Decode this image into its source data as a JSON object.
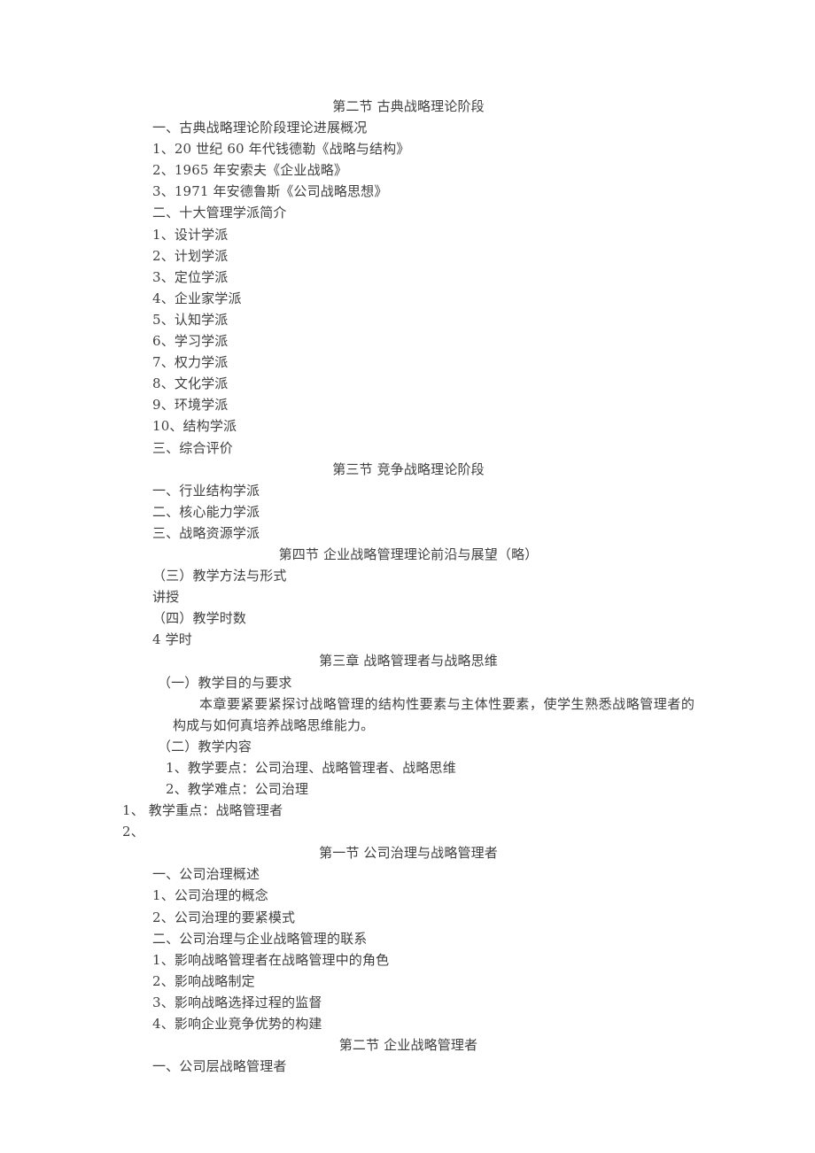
{
  "document": {
    "title": "企业战略管理教学大纲",
    "text_color": "#3f3f3f",
    "background_color": "#ffffff"
  },
  "blocks": [
    {
      "kind": "heading",
      "indent": "center",
      "text": "第二节      古典战略理论阶段"
    },
    {
      "kind": "line",
      "indent": "body",
      "text": "一、古典战略理论阶段理论进展概况"
    },
    {
      "kind": "line",
      "indent": "body",
      "text": "1、20 世纪 60 年代钱德勒《战略与结构》"
    },
    {
      "kind": "line",
      "indent": "body",
      "text": "2、1965 年安索夫《企业战略》"
    },
    {
      "kind": "line",
      "indent": "body",
      "text": "3、1971 年安德鲁斯《公司战略思想》"
    },
    {
      "kind": "line",
      "indent": "body",
      "text": "二、十大管理学派简介"
    },
    {
      "kind": "line",
      "indent": "body",
      "text": "1、设计学派"
    },
    {
      "kind": "line",
      "indent": "body",
      "text": "2、计划学派"
    },
    {
      "kind": "line",
      "indent": "body",
      "text": "3、定位学派"
    },
    {
      "kind": "line",
      "indent": "body",
      "text": "4、企业家学派"
    },
    {
      "kind": "line",
      "indent": "body",
      "text": "5、认知学派"
    },
    {
      "kind": "line",
      "indent": "body",
      "text": "6、学习学派"
    },
    {
      "kind": "line",
      "indent": "body",
      "text": "7、权力学派"
    },
    {
      "kind": "line",
      "indent": "body",
      "text": "8、文化学派"
    },
    {
      "kind": "line",
      "indent": "body",
      "text": "9、环境学派"
    },
    {
      "kind": "line",
      "indent": "body",
      "text": "10、结构学派"
    },
    {
      "kind": "line",
      "indent": "body",
      "text": "三、综合评价"
    },
    {
      "kind": "heading",
      "indent": "center",
      "text": "第三节      竞争战略理论阶段"
    },
    {
      "kind": "line",
      "indent": "body",
      "text": "一、行业结构学派"
    },
    {
      "kind": "line",
      "indent": "body",
      "text": "二、核心能力学派"
    },
    {
      "kind": "line",
      "indent": "body",
      "text": "三、战略资源学派"
    },
    {
      "kind": "heading",
      "indent": "center",
      "text": "第四节      企业战略管理理论前沿与展望（略）"
    },
    {
      "kind": "line",
      "indent": "body",
      "text": "（三）教学方法与形式"
    },
    {
      "kind": "line",
      "indent": "body",
      "text": "讲授"
    },
    {
      "kind": "line",
      "indent": "body",
      "text": "（四）教学时数"
    },
    {
      "kind": "line",
      "indent": "body",
      "text": "4 学时"
    },
    {
      "kind": "heading",
      "indent": "center",
      "text": "第三章    战略管理者与战略思维"
    },
    {
      "kind": "line",
      "indent": "sub1",
      "text": "（一）教学目的与要求"
    },
    {
      "kind": "paragraph",
      "indent": "para",
      "text": "本章要紧要紧探讨战略管理的结构性要素与主体性要素，使学生熟悉战略管理者的构成与如何真培养战略思维能力。"
    },
    {
      "kind": "line",
      "indent": "sub1",
      "text": "（二）教学内容"
    },
    {
      "kind": "line",
      "indent": "sub2",
      "text": "1、教学要点：公司治理、战略管理者、战略思维"
    },
    {
      "kind": "line",
      "indent": "sub2",
      "text": "2、教学难点：公司治理"
    },
    {
      "kind": "line",
      "indent": "flush",
      "text": "1、 教学重点：战略管理者"
    },
    {
      "kind": "line",
      "indent": "flush",
      "text": "2、"
    },
    {
      "kind": "heading",
      "indent": "center",
      "text": "第一节     公司治理与战略管理者"
    },
    {
      "kind": "line",
      "indent": "body",
      "text": "一、公司治理概述"
    },
    {
      "kind": "line",
      "indent": "body",
      "text": "1、公司治理的概念"
    },
    {
      "kind": "line",
      "indent": "body",
      "text": "2、公司治理的要紧模式"
    },
    {
      "kind": "line",
      "indent": "body",
      "text": "二、公司治理与企业战略管理的联系"
    },
    {
      "kind": "line",
      "indent": "body",
      "text": "1、影响战略管理者在战略管理中的角色"
    },
    {
      "kind": "line",
      "indent": "body",
      "text": "2、影响战略制定"
    },
    {
      "kind": "line",
      "indent": "body",
      "text": "3、影响战略选择过程的监督"
    },
    {
      "kind": "line",
      "indent": "body",
      "text": "4、影响企业竞争优势的构建"
    },
    {
      "kind": "heading",
      "indent": "center",
      "text": "第二节      企业战略管理者"
    },
    {
      "kind": "line",
      "indent": "body",
      "text": "一、公司层战略管理者"
    }
  ]
}
